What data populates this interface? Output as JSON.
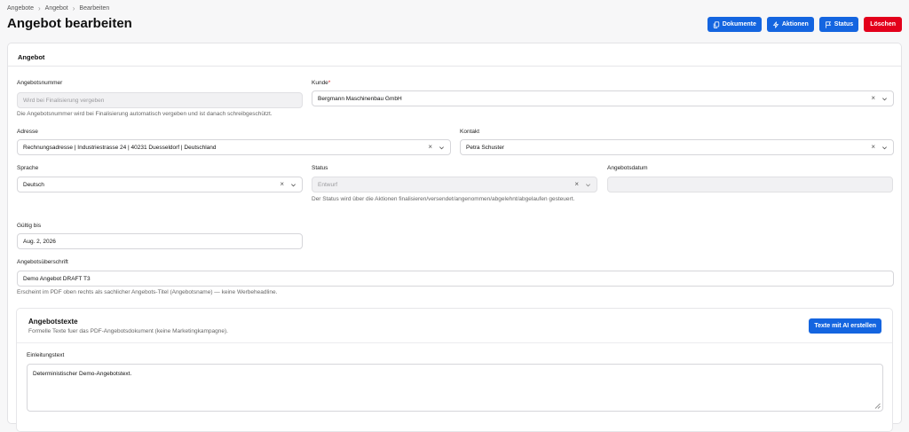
{
  "breadcrumb": [
    "Angebote",
    "Angebot",
    "Bearbeiten"
  ],
  "page_title": "Angebot bearbeiten",
  "actions": {
    "dokumente": "Dokumente",
    "aktionen": "Aktionen",
    "status": "Status",
    "loeschen": "Löschen"
  },
  "colors": {
    "primary": "#1465e0",
    "danger": "#e3001b"
  },
  "card_title": "Angebot",
  "fields": {
    "angebotsnummer": {
      "label": "Angebotsnummer",
      "placeholder": "Wird bei Finalisierung vergeben",
      "help": "Die Angebotsnummer wird bei Finalisierung automatisch vergeben und ist danach schreibgeschützt."
    },
    "kunde": {
      "label": "Kunde",
      "required_mark": "*",
      "value": "Bergmann Maschinenbau GmbH"
    },
    "adresse": {
      "label": "Adresse",
      "value": "Rechnungsadresse | Industriestrasse 24 | 40231 Duesseldorf | Deutschland"
    },
    "kontakt": {
      "label": "Kontakt",
      "value": "Petra Schuster"
    },
    "sprache": {
      "label": "Sprache",
      "value": "Deutsch"
    },
    "status": {
      "label": "Status",
      "value": "Entwurf",
      "help": "Der Status wird über die Aktionen finalisieren/versendet/angenommen/abgelehnt/abgelaufen gesteuert."
    },
    "angebotsdatum": {
      "label": "Angebotsdatum",
      "value": ""
    },
    "gueltig_bis": {
      "label": "Gültig bis",
      "value": "Aug. 2, 2026"
    },
    "ueberschrift": {
      "label": "Angebotsüberschrift",
      "value": "Demo Angebot DRAFT T3",
      "help": "Erscheint im PDF oben rechts als sachlicher Angebots-Titel (Angebotsname) — keine Werbeheadline."
    }
  },
  "angebotstexte": {
    "title": "Angebotstexte",
    "description": "Formelle Texte fuer das PDF-Angebotsdokument (keine Marketingkampagne).",
    "ai_button": "Texte mit AI erstellen",
    "einleitung_label": "Einleitungstext",
    "einleitung_value": "Deterministischer Demo-Angebotstext."
  }
}
